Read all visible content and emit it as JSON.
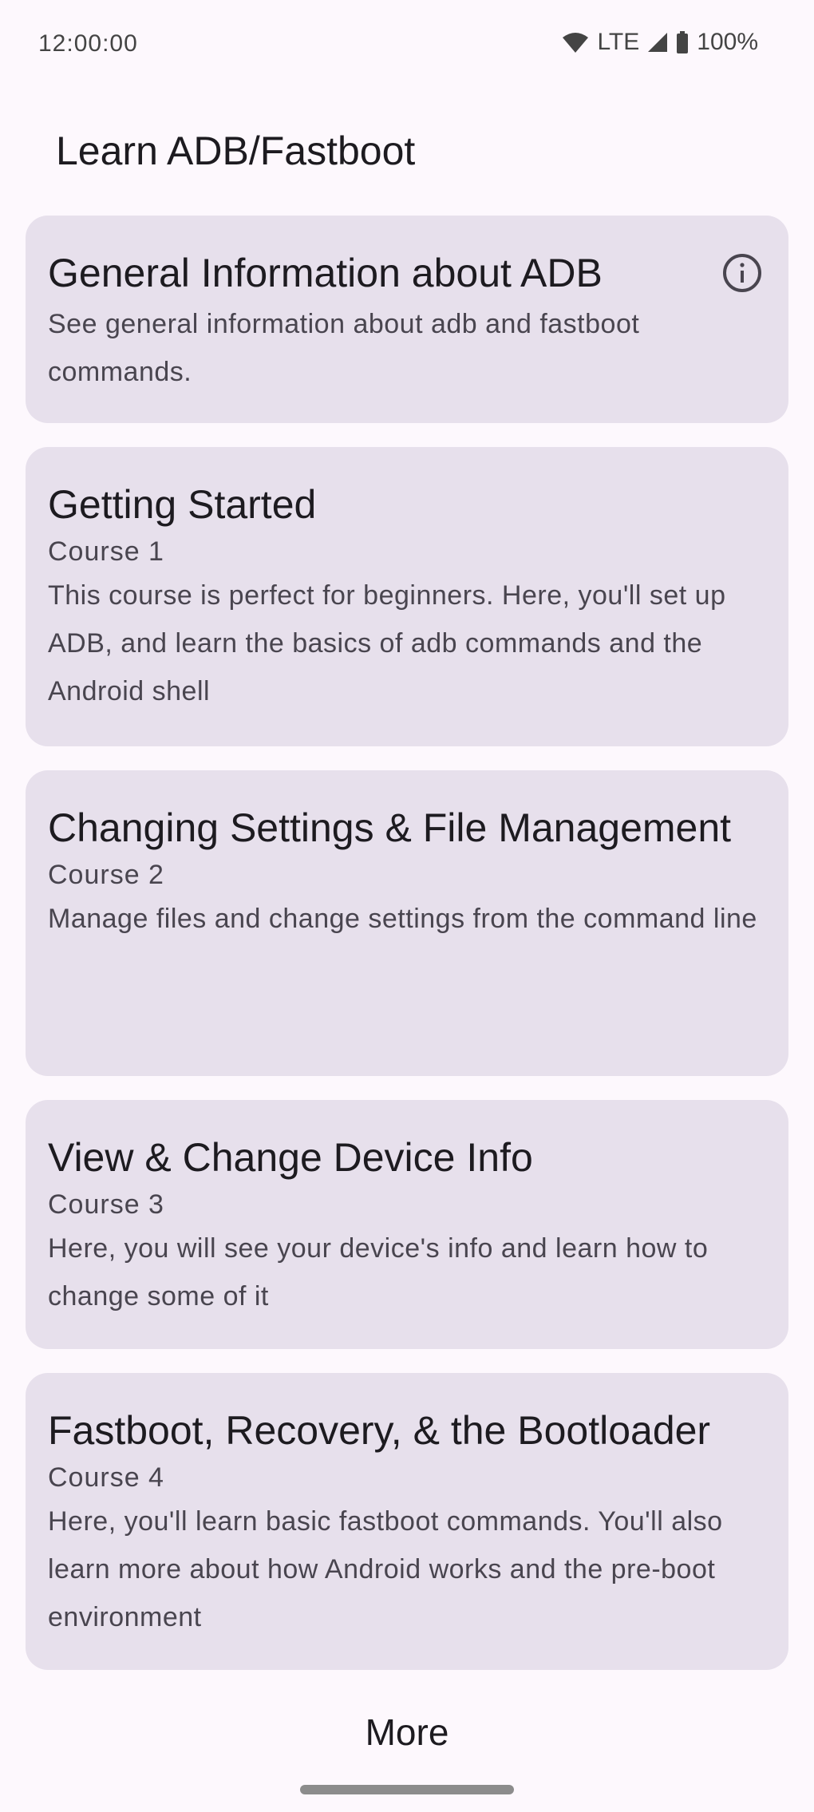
{
  "status_bar": {
    "time": "12:00:00",
    "network": "LTE",
    "battery": "100%"
  },
  "app": {
    "title": "Learn ADB/Fastboot"
  },
  "general_card": {
    "title": "General Information about ADB",
    "description": "See general information about adb and fastboot commands.",
    "icon": "info-icon"
  },
  "courses": [
    {
      "title": "Getting Started",
      "course": "Course 1",
      "description": "This course is perfect for beginners. Here, you'll set up ADB, and learn the basics of adb commands and the Android shell"
    },
    {
      "title": "Changing Settings & File Management",
      "course": "Course 2",
      "description": "Manage files and change settings from the command line"
    },
    {
      "title": "View & Change Device Info",
      "course": "Course 3",
      "description": "Here, you will see your device's info and learn how to change some of it"
    },
    {
      "title": "Fastboot, Recovery, & the Bootloader",
      "course": "Course 4",
      "description": "Here, you'll learn basic fastboot commands. You'll also learn more about how Android works and the pre-boot environment"
    }
  ],
  "more_button": {
    "label": "More"
  },
  "colors": {
    "background": "#fdf8fd",
    "card": "#e7e0ec",
    "text_primary": "#1d1b20",
    "text_secondary": "#49454f"
  }
}
